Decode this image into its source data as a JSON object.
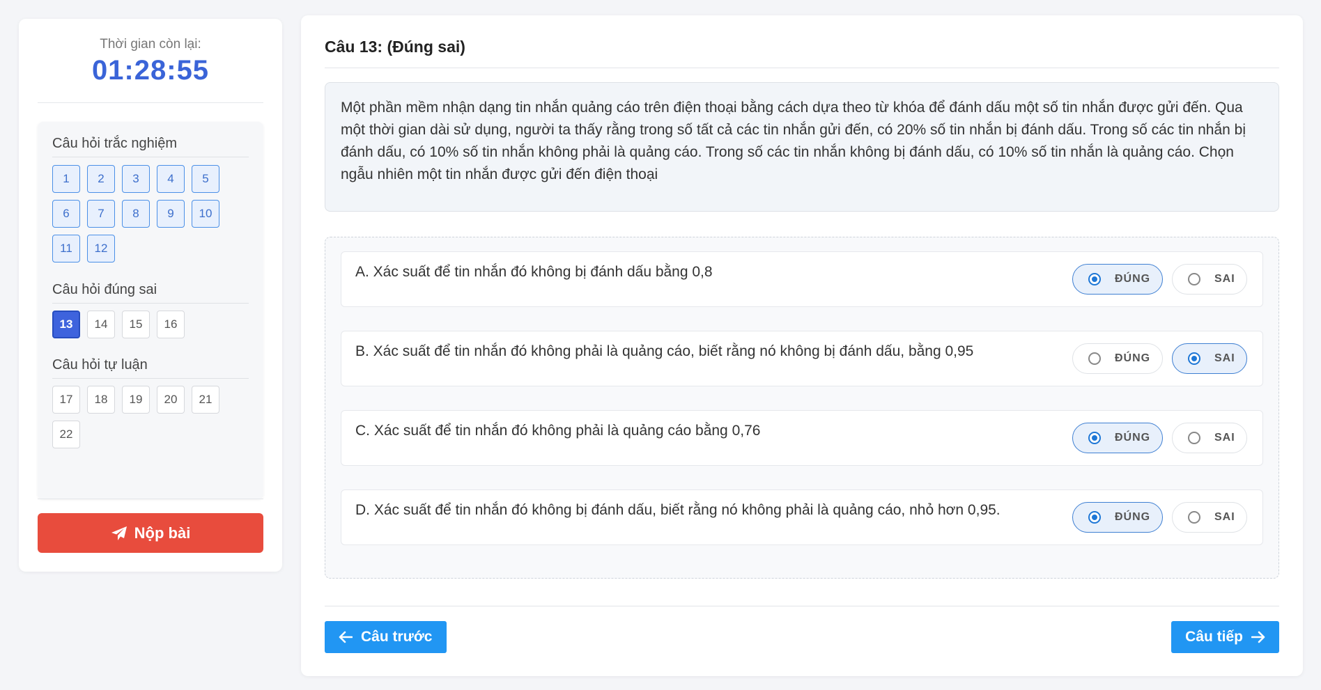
{
  "timer": {
    "label": "Thời gian còn lại:",
    "value": "01:28:55"
  },
  "nav": {
    "groups": [
      {
        "title": "Câu hỏi trắc nghiệm",
        "items": [
          "1",
          "2",
          "3",
          "4",
          "5",
          "6",
          "7",
          "8",
          "9",
          "10",
          "11",
          "12"
        ]
      },
      {
        "title": "Câu hỏi đúng sai",
        "items": [
          "13",
          "14",
          "15",
          "16"
        ]
      },
      {
        "title": "Câu hỏi tự luận",
        "items": [
          "17",
          "18",
          "19",
          "20",
          "21",
          "22"
        ]
      }
    ],
    "current": "13"
  },
  "submit": {
    "label": "Nộp bài",
    "icon": "paper-plane-icon"
  },
  "question": {
    "title": "Câu 13: (Đúng sai)",
    "text": "Một phần mềm nhận dạng tin nhắn quảng cáo trên điện thoại bằng cách dựa theo từ khóa để đánh dấu một số tin nhắn được gửi đến. Qua một thời gian dài sử dụng, người ta thấy rằng trong số tất cả các tin nhắn gửi đến, có 20% số tin nhắn bị đánh dấu. Trong số các tin nhắn bị đánh dấu, có 10% số tin nhắn không phải là quảng cáo. Trong số các tin nhắn không bị đánh dấu, có 10% số tin nhắn là quảng cáo. Chọn ngẫu nhiên một tin nhắn được gửi đến điện thoại",
    "true_label": "ĐÚNG",
    "false_label": "SAI",
    "options": [
      {
        "text": "A. Xác suất để tin nhắn đó không bị đánh dấu bằng 0,8",
        "selected": "true"
      },
      {
        "text": "B. Xác suất để tin nhắn đó không phải là quảng cáo, biết rằng nó không bị đánh dấu, bằng 0,95",
        "selected": "false"
      },
      {
        "text": "C. Xác suất để tin nhắn đó không phải là quảng cáo bằng 0,76",
        "selected": "true"
      },
      {
        "text": "D. Xác suất để tin nhắn đó không bị đánh dấu, biết rằng nó không phải là quảng cáo, nhỏ hơn 0,95.",
        "selected": "true"
      }
    ]
  },
  "footer": {
    "prev_label": "Câu trước",
    "next_label": "Câu tiếp"
  },
  "colors": {
    "accent": "#2196f3",
    "submit": "#e84c3d",
    "timer": "#3a64d8",
    "current_question": "#3e63dd"
  }
}
